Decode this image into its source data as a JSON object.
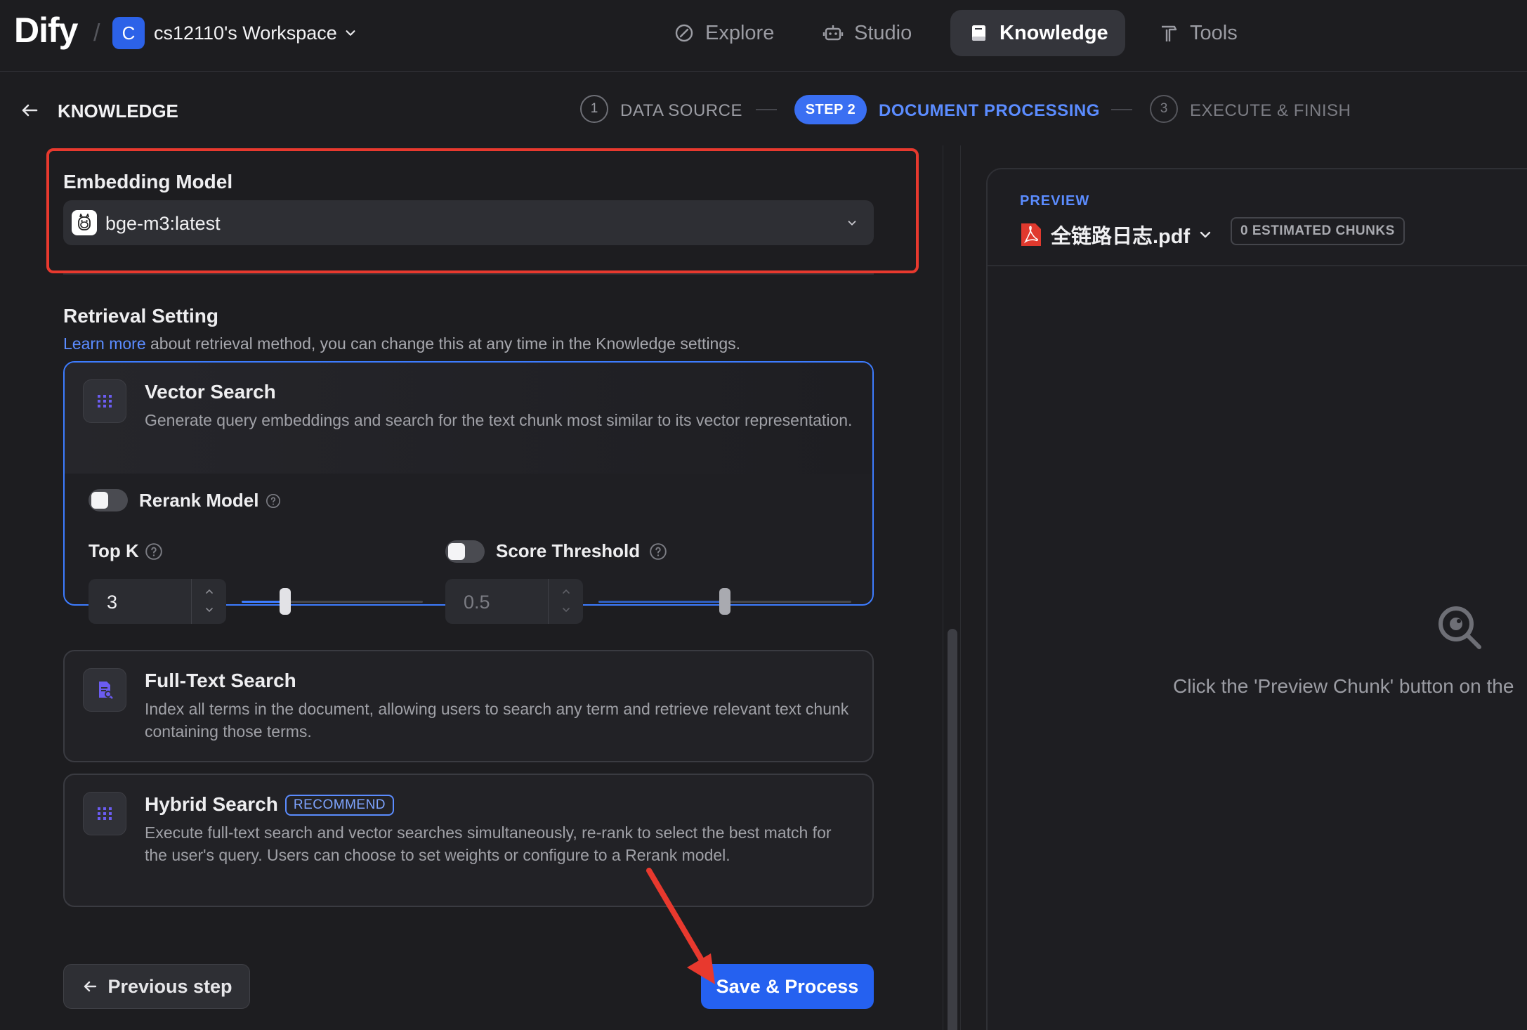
{
  "brand": {
    "logo_text": "Dify",
    "separator": "/"
  },
  "workspace": {
    "avatar_letter": "C",
    "name": "cs12110's Workspace"
  },
  "nav": {
    "items": [
      {
        "label": "Explore",
        "icon": "compass-icon",
        "active": false
      },
      {
        "label": "Studio",
        "icon": "robot-icon",
        "active": false
      },
      {
        "label": "Knowledge",
        "icon": "book-icon",
        "active": true
      },
      {
        "label": "Tools",
        "icon": "hammer-icon",
        "active": false
      }
    ]
  },
  "subheader": {
    "back_label": "KNOWLEDGE",
    "steps": [
      {
        "number": "1",
        "label": "DATA SOURCE"
      },
      {
        "pill": "STEP 2",
        "label": "DOCUMENT PROCESSING"
      },
      {
        "number": "3",
        "label": "EXECUTE & FINISH"
      }
    ]
  },
  "embedding": {
    "title": "Embedding Model",
    "selected_model": "bge-m3:latest",
    "model_icon": "llama-icon"
  },
  "retrieval": {
    "title": "Retrieval Setting",
    "desc_link": "Learn more",
    "desc_rest": " about retrieval method, you can change this at any time in the Knowledge settings.",
    "vector": {
      "title": "Vector Search",
      "desc": "Generate query embeddings and search for the text chunk most similar to its vector representation.",
      "rerank_label": "Rerank Model",
      "rerank_enabled": false,
      "topk_label": "Top K",
      "topk_value": "3",
      "topk_slider_fraction": 0.24,
      "score_label": "Score Threshold",
      "score_enabled": false,
      "score_value": "0.5",
      "score_slider_fraction": 0.5
    },
    "fulltext": {
      "title": "Full-Text Search",
      "desc": "Index all terms in the document, allowing users to search any term and retrieve relevant text chunk containing those terms."
    },
    "hybrid": {
      "title": "Hybrid Search",
      "badge": "RECOMMEND",
      "desc": "Execute full-text search and vector searches simultaneously, re-rank to select the best match for the user's query. Users can choose to set weights or configure to a Rerank model."
    }
  },
  "actions": {
    "prev_label": "Previous step",
    "save_label": "Save & Process"
  },
  "preview": {
    "label": "PREVIEW",
    "file_name": "全链路日志.pdf",
    "chunks_badge": "0 ESTIMATED CHUNKS",
    "empty_hint": "Click the 'Preview Chunk' button on the"
  },
  "colors": {
    "accent": "#3d7cff",
    "primary_button": "#2561f0",
    "highlight_border": "#e8392e",
    "annotation_arrow": "#e8392e"
  }
}
